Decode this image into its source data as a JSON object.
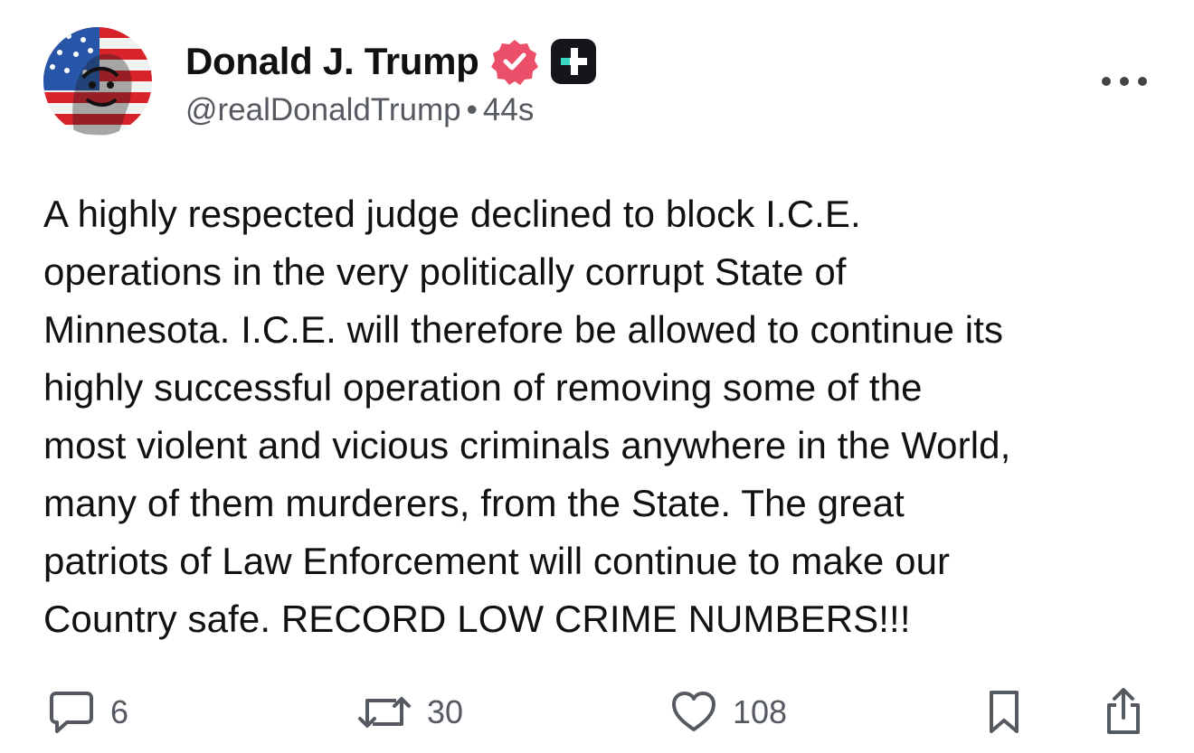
{
  "post": {
    "author": {
      "display_name": "Donald J. Trump",
      "handle": "@realDonaldTrump",
      "separator": "•",
      "timestamp": "44s",
      "verified": true,
      "avatar": "flag-portrait-avatar"
    },
    "more_icon": "more-horizontal-icon",
    "body_lines": [
      "A highly respected judge declined to block I.C.E.",
      "operations in the very politically corrupt State of",
      "Minnesota. I.C.E. will therefore be allowed to continue its",
      "highly successful operation of removing some of the",
      "most violent and vicious criminals anywhere in the World,",
      "many of them murderers, from the State. The great",
      "patriots of Law Enforcement will continue to make our",
      "Country safe. RECORD LOW CRIME NUMBERS!!!"
    ],
    "actions": {
      "replies": {
        "icon": "reply-icon",
        "count": "6"
      },
      "retruths": {
        "icon": "retruth-icon",
        "count": "30"
      },
      "likes": {
        "icon": "heart-icon",
        "count": "108"
      },
      "bookmark": {
        "icon": "bookmark-icon"
      },
      "share": {
        "icon": "share-icon"
      }
    }
  },
  "colors": {
    "text": "#111111",
    "muted": "#555960",
    "verified_badge": "#ec4f6a",
    "plus_badge_bg": "#14161b",
    "plus_badge_accent": "#3ad8c4"
  }
}
